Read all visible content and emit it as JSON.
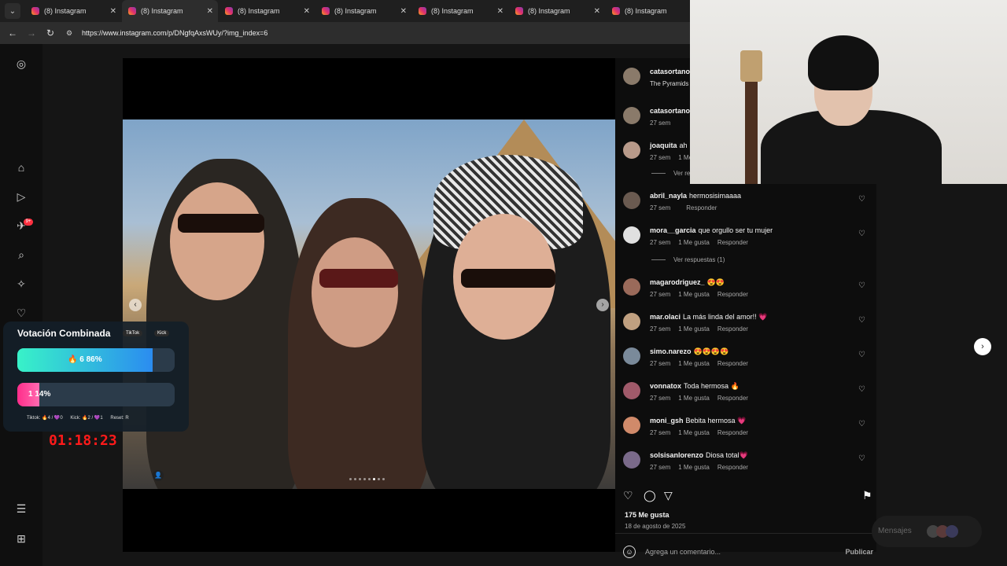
{
  "browser": {
    "tabs": [
      {
        "label": "(8) Instagram",
        "active": false
      },
      {
        "label": "(8) Instagram",
        "active": true
      },
      {
        "label": "(8) Instagram",
        "active": false
      },
      {
        "label": "(8) Instagram",
        "active": false
      },
      {
        "label": "(8) Instagram",
        "active": false
      },
      {
        "label": "(8) Instagram",
        "active": false
      },
      {
        "label": "(8) Instagram",
        "active": false
      }
    ],
    "url": "https://www.instagram.com/p/DNgfqAxsWUy/?img_index=6"
  },
  "sidebar": {
    "notification_badge": "9+"
  },
  "post": {
    "author": "catasortano",
    "location": "The Pyramids -",
    "likes": "175 Me gusta",
    "date": "18 de agosto de 2025",
    "comment_placeholder": "Agrega un comentario...",
    "publish_label": "Publicar",
    "carousel_dot_count": 8,
    "carousel_active_index": 5
  },
  "comments": [
    {
      "user": "catasortano",
      "text": "",
      "time": "27 sem",
      "likes": "",
      "reply": ""
    },
    {
      "user": "joaquita",
      "text": "ah",
      "time": "27 sem",
      "likes": "1 Me",
      "reply": ""
    },
    {
      "user": "abril_nayla",
      "text": "hermosisimaaaa",
      "time": "27 sem",
      "likes": "",
      "reply": "Responder"
    },
    {
      "user": "mora__garcia",
      "text": "que orgullo ser tu mujer",
      "time": "27 sem",
      "likes": "1 Me gusta",
      "reply": "Responder"
    },
    {
      "user": "magarodriguez_",
      "text": "😍😍",
      "time": "27 sem",
      "likes": "1 Me gusta",
      "reply": "Responder"
    },
    {
      "user": "mar.olaci",
      "text": "La más linda del amor!! 💗",
      "time": "27 sem",
      "likes": "1 Me gusta",
      "reply": "Responder"
    },
    {
      "user": "simo.narezo",
      "text": "😍😍😍😍",
      "time": "27 sem",
      "likes": "1 Me gusta",
      "reply": "Responder"
    },
    {
      "user": "vonnatox",
      "text": "Toda hermosa 🔥",
      "time": "27 sem",
      "likes": "1 Me gusta",
      "reply": "Responder"
    },
    {
      "user": "moni_gsh",
      "text": "Bebita hermosa 💗",
      "time": "27 sem",
      "likes": "1 Me gusta",
      "reply": "Responder"
    },
    {
      "user": "solsisanlorenzo",
      "text": "Diosa total💗",
      "time": "27 sem",
      "likes": "1 Me gusta",
      "reply": "Responder"
    }
  ],
  "replies": {
    "first": "Ver re",
    "second": "Ver respuestas (1)"
  },
  "messages": {
    "label": "Mensajes"
  },
  "overlay": {
    "title": "Votación Combinada",
    "platforms": [
      "TikTok",
      "Kick"
    ],
    "option1": {
      "text": "6  86%",
      "value": 86
    },
    "option2": {
      "text": "1  14%",
      "value": 14
    },
    "footer": [
      "Tiktok: 🔥4 / 💜0",
      "Kick: 🔥2 / 💜1",
      "Reset: R"
    ],
    "timer": "01:18:23"
  },
  "colors": {
    "accent_bar1_start": "#38f2c8",
    "accent_bar1_end": "#2b8cf0",
    "accent_bar2": "#ff2d8a",
    "timer": "#ff1a1a"
  }
}
